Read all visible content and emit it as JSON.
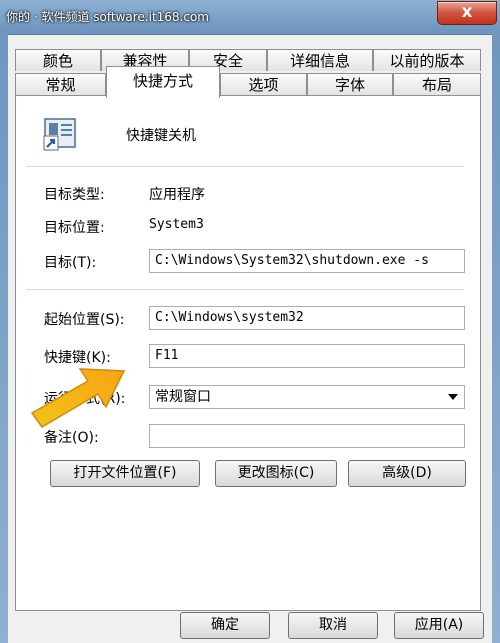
{
  "watermark": "你的 · 软件频道 software.it168.com",
  "close_glyph": "x",
  "tabs_top": [
    "颜色",
    "兼容性",
    "安全",
    "详细信息",
    "以前的版本"
  ],
  "tabs_bottom": [
    "常规",
    "快捷方式",
    "选项",
    "字体",
    "布局"
  ],
  "shortcut_name": "快捷键关机",
  "fields": {
    "target_type_label": "目标类型:",
    "target_type_value": "应用程序",
    "target_location_label": "目标位置:",
    "target_location_value": "System3",
    "target_label": "目标(T):",
    "target_value": "C:\\Windows\\System32\\shutdown.exe -s",
    "start_in_label": "起始位置(S):",
    "start_in_value": "C:\\Windows\\system32",
    "hotkey_label": "快捷键(K):",
    "hotkey_value": "F11",
    "run_label": "运行方式(R):",
    "run_value": "常规窗口",
    "comment_label": "备注(O):",
    "comment_value": ""
  },
  "buttons": {
    "open_location": "打开文件位置(F)",
    "change_icon": "更改图标(C)",
    "advanced": "高级(D)",
    "ok": "确定",
    "cancel": "取消",
    "apply": "应用(A)"
  }
}
